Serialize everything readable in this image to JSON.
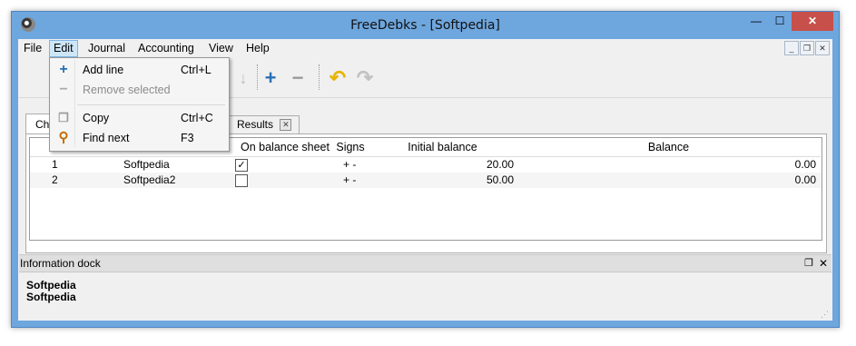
{
  "window": {
    "title": "FreeDebks - [Softpedia]"
  },
  "title_buttons": {
    "minimize": "—",
    "maximize": "☐",
    "close": "✕"
  },
  "menubar": {
    "file": "File",
    "edit": "Edit",
    "journal": "Journal",
    "accounting": "Accounting",
    "view": "View",
    "help": "Help"
  },
  "mdi_controls": {
    "minimize": "_",
    "restore": "❐",
    "close": "✕"
  },
  "tabs": {
    "first": "Ch",
    "results": "Results"
  },
  "table": {
    "headers": {
      "on_balance_sheet": "On balance sheet",
      "signs": "Signs",
      "initial_balance": "Initial balance",
      "balance": "Balance"
    },
    "rows": [
      {
        "num": "1",
        "name": "Softpedia",
        "on_balance_sheet": true,
        "signs": "+ -",
        "initial_balance": "20.00",
        "balance": "0.00"
      },
      {
        "num": "2",
        "name": "Softpedia2",
        "on_balance_sheet": false,
        "signs": "+ -",
        "initial_balance": "50.00",
        "balance": "0.00"
      }
    ]
  },
  "dock": {
    "title": "Information dock",
    "line1": "Softpedia",
    "line2": "Softpedia"
  },
  "edit_menu": {
    "add_line": {
      "label": "Add line",
      "shortcut": "Ctrl+L"
    },
    "remove_selected": {
      "label": "Remove selected"
    },
    "copy": {
      "label": "Copy",
      "shortcut": "Ctrl+C"
    },
    "find_next": {
      "label": "Find next",
      "shortcut": "F3"
    }
  },
  "colors": {
    "titlebar": "#6ea6de",
    "close": "#c7504b",
    "accent_plus": "#2a6fb5",
    "undo_yellow": "#e7b400"
  }
}
